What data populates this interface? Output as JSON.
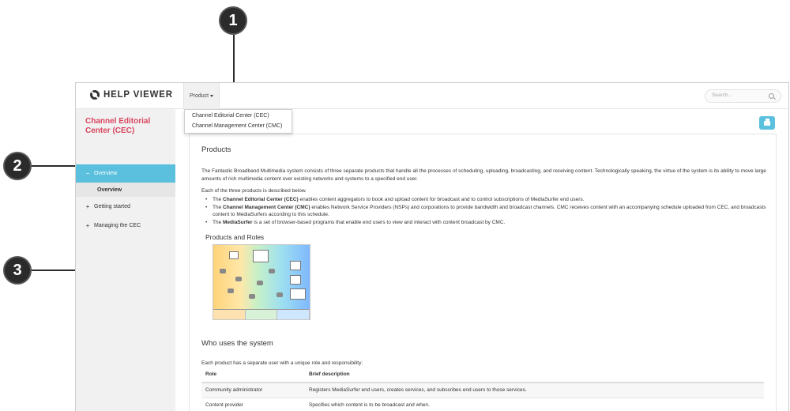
{
  "callouts": [
    "1",
    "2",
    "3"
  ],
  "brand": {
    "title": "HELP VIEWER"
  },
  "topbar": {
    "product_label": "Product",
    "search_placeholder": "Search..."
  },
  "dropdown": {
    "items": [
      "Channel Editorial Center (CEC)",
      "Channel Management Center (CMC)"
    ]
  },
  "sidebar": {
    "title": "Channel Editorial Center (CEC)",
    "items": [
      {
        "sign": "−",
        "label": "Overview",
        "active": true
      },
      {
        "sign": "",
        "label": "Overview",
        "sub": true
      },
      {
        "sign": "+",
        "label": "Getting started"
      },
      {
        "sign": "+",
        "label": "Managing the CEC"
      }
    ]
  },
  "content": {
    "heading": "Products",
    "intro": "The Fantastic Broadband Multimedia system consists of three separate products that handle all the processes of scheduling, uploading, broadcasting, and receiving content. Technologically speaking, the virtue of the system is its ability to move large amounts of rich multimedia content over existing networks and systems to a specified end user.",
    "intro2": "Each of the three products is described below.",
    "bullets": [
      {
        "pre": "The ",
        "bold": "Channel Editorial Center (CEC)",
        "post": " enables content aggregators to book and upload content for broadcast and to control subscriptions of MediaSurfer end users."
      },
      {
        "pre": "The ",
        "bold": "Channel Management Center (CMC)",
        "post": " enables Network Service Providers (NSPs) and corporations to provide bandwidth and broadcast channels. CMC receives content with an accompanying schedule uploaded from CEC, and broadcasts content to MediaSurfers according to this schedule."
      },
      {
        "pre": "The ",
        "bold": "MediaSurfer",
        "post": " is a set of browser-based programs that enable end users to view and interact with content broadcast by CMC."
      }
    ],
    "roles_heading": "Products and Roles",
    "who_heading": "Who uses the system",
    "who_intro": "Each product has a separate user with a unique role and responsibility:",
    "table": {
      "headers": [
        "Role",
        "Brief description"
      ],
      "rows": [
        [
          "Community administrator",
          "Registers MediaSurfer end users, creates services, and subscribes end users to those services."
        ],
        [
          "Content provider",
          "Specifies which content is to be broadcast and when."
        ]
      ]
    }
  }
}
